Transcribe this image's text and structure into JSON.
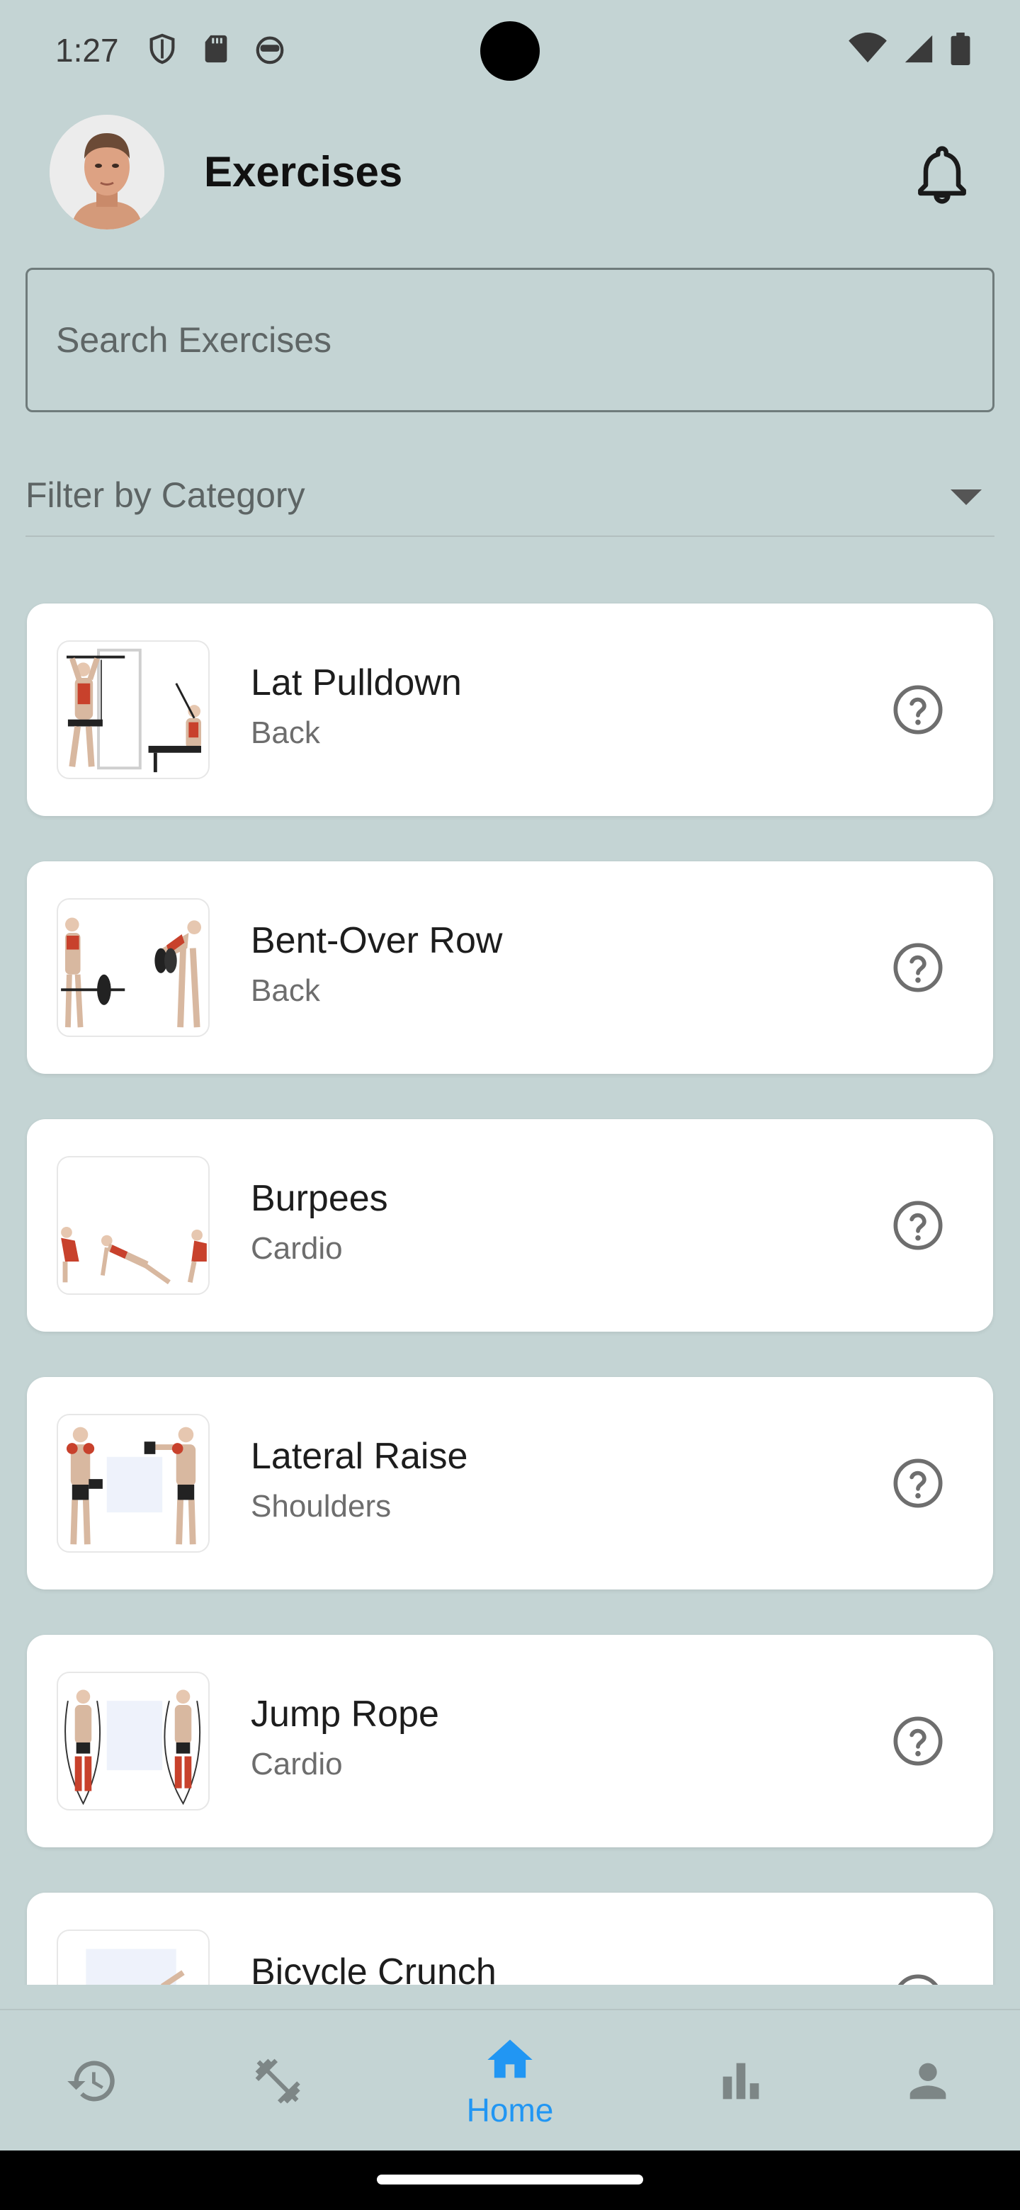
{
  "status_bar": {
    "time": "1:27",
    "left_icons": [
      "shield-icon",
      "sd-card-icon",
      "android-face-icon"
    ],
    "right_icons": [
      "wifi-icon",
      "signal-icon",
      "battery-icon"
    ]
  },
  "header": {
    "title": "Exercises",
    "avatar": "profile-avatar",
    "notification_icon": "bell-icon"
  },
  "search": {
    "placeholder": "Search Exercises",
    "value": ""
  },
  "filter": {
    "label": "Filter by Category",
    "icon": "dropdown-arrow-icon"
  },
  "exercises": [
    {
      "name": "Lat Pulldown",
      "category": "Back"
    },
    {
      "name": "Bent-Over Row",
      "category": "Back"
    },
    {
      "name": "Burpees",
      "category": "Cardio"
    },
    {
      "name": "Lateral Raise",
      "category": "Shoulders"
    },
    {
      "name": "Jump Rope",
      "category": "Cardio"
    },
    {
      "name": "Bicycle Crunch",
      "category": ""
    }
  ],
  "bottom_nav": {
    "items": [
      {
        "icon": "history-icon",
        "label": ""
      },
      {
        "icon": "dumbbell-icon",
        "label": ""
      },
      {
        "icon": "home-icon",
        "label": "Home",
        "active": true
      },
      {
        "icon": "bar-chart-icon",
        "label": ""
      },
      {
        "icon": "person-icon",
        "label": ""
      }
    ]
  },
  "colors": {
    "background": "#c4d4d4",
    "card": "#ffffff",
    "accent": "#2196f3",
    "icon_inactive": "#7d8686",
    "muscle": "#c8412c"
  }
}
